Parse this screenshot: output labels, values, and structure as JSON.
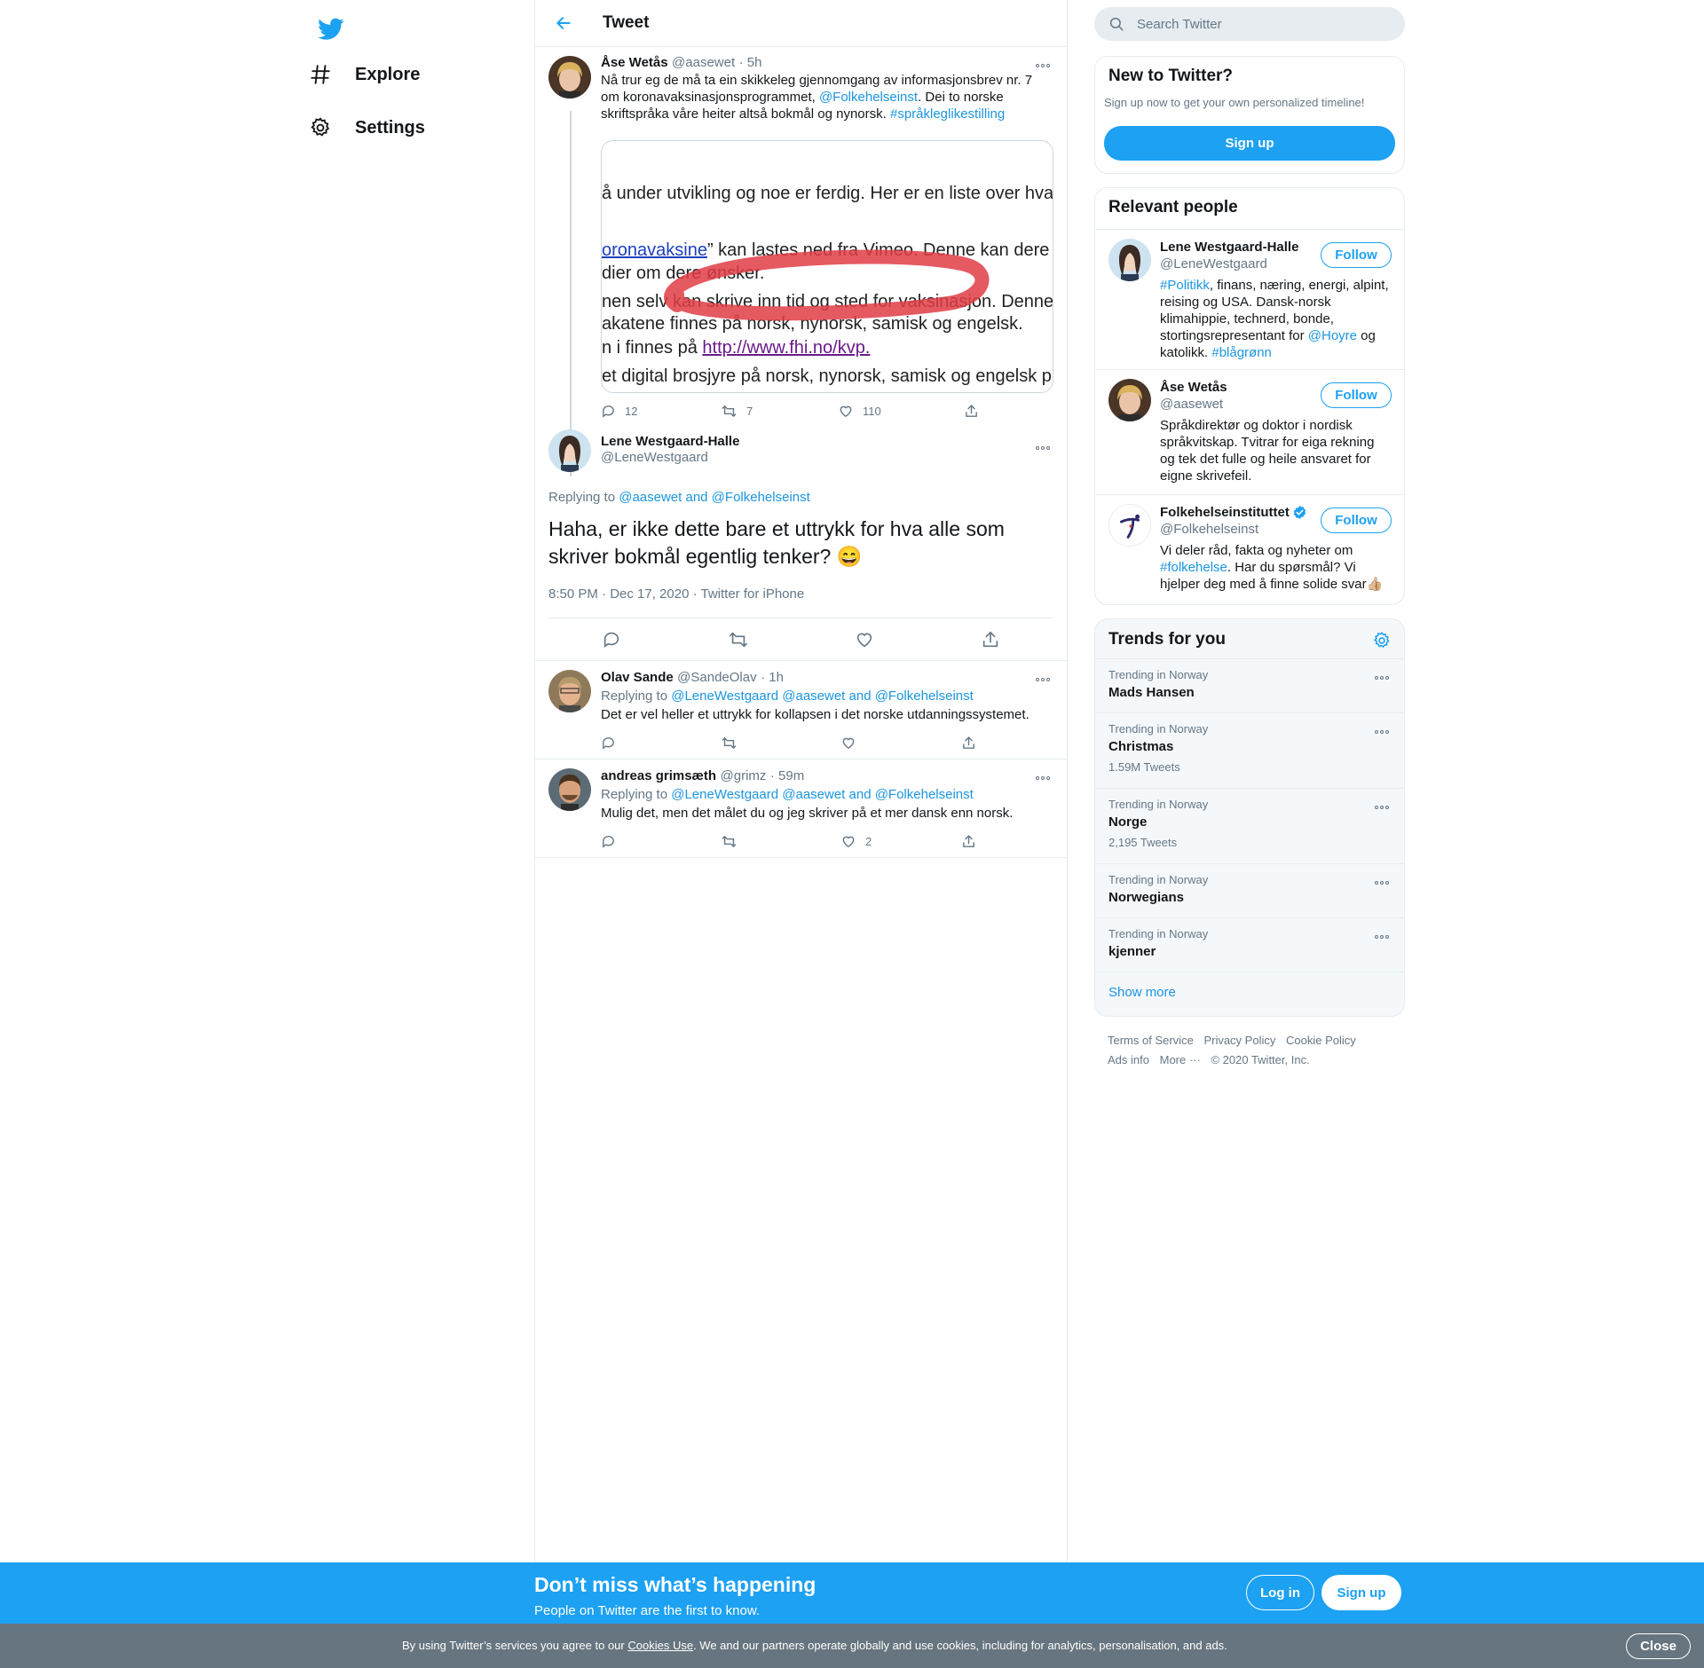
{
  "nav": {
    "items": [
      {
        "label": "Explore",
        "icon": "hashtag-icon"
      },
      {
        "label": "Settings",
        "icon": "gear-icon"
      }
    ]
  },
  "header": {
    "title": "Tweet"
  },
  "parent_tweet": {
    "name": "Åse Wetås",
    "handle": "@aasewet",
    "time": "· 5h",
    "text_1": "Nå trur eg de må ta ein skikkeleg gjennomgang av informasjonsbrev nr. 7 om koronavaksinasjonsprogrammet, ",
    "mention": "@Folkehelseinst",
    "text_2": ". Dei to norske skriftspråka våre heiter altså bokmål og nynorsk. ",
    "hashtag": "#språkleglikestilling",
    "image_lines": [
      "å under utvikling og noe er ferdig. Her er en liste over hva so",
      "oronavaksine",
      "” kan lastes ned fra Vimeo. Denne kan dere legg",
      "dier om dere ønsker.",
      "nen selv kan skrive inn tid og sted for vaksinasjon. Denne vil",
      "akatene finnes på norsk, nynorsk, samisk og engelsk.",
      "n i finnes på ",
      "http://www.fhi.no/kvp.",
      "et digital brosjyre på norsk, nynorsk, samisk og engelsk publ"
    ],
    "replies": "12",
    "retweets": "7",
    "likes": "110"
  },
  "focus_tweet": {
    "name": "Lene Westgaard-Halle",
    "handle": "@LeneWestgaard",
    "replying_label": "Replying to ",
    "replying_to": "@aasewet and @Folkehelseinst",
    "text": "Haha, er ikke dette bare et uttrykk for hva alle som skriver bokmål egentlig tenker? 😄",
    "meta": "8:50 PM · Dec 17, 2020 · Twitter for iPhone"
  },
  "replies": [
    {
      "name": "Olav Sande",
      "handle": "@SandeOlav",
      "time": "· 1h",
      "replying_label": "Replying to ",
      "replying_to": "@LeneWestgaard @aasewet and @Folkehelseinst",
      "text": "Det er vel heller et uttrykk for kollapsen i det norske utdanningssystemet.",
      "likes": ""
    },
    {
      "name": "andreas grimsæth",
      "handle": "@grimz",
      "time": "· 59m",
      "replying_label": "Replying to ",
      "replying_to": "@LeneWestgaard @aasewet and @Folkehelseinst",
      "text": "Mulig det, men det målet du og jeg skriver på et mer dansk enn norsk.",
      "likes": "2"
    }
  ],
  "search": {
    "placeholder": "Search Twitter"
  },
  "new_to_twitter": {
    "title": "New to Twitter?",
    "subtitle": "Sign up now to get your own personalized timeline!",
    "button": "Sign up"
  },
  "relevant_people": {
    "title": "Relevant people",
    "follow_label": "Follow",
    "people": [
      {
        "name": "Lene Westgaard-Halle",
        "handle": "@LeneWestgaard",
        "bio_hashtag": "#Politikk",
        "bio_1": ", finans, næring, energi, alpint, reising og USA. Dansk-norsk klimahippie, technerd, bonde, stortingsrepresentant for ",
        "bio_mention": "@Hoyre",
        "bio_2": " og katolikk. ",
        "bio_hashtag2": "#blågrønn"
      },
      {
        "name": "Åse Wetås",
        "handle": "@aasewet",
        "bio": "Språkdirektør og doktor i nordisk språkvitskap. Tvitrar for eiga rekning og tek det fulle og heile ansvaret for eigne skrivefeil."
      },
      {
        "name": "Folkehelseinstituttet",
        "handle": "@Folkehelseinst",
        "verified": true,
        "bio_1": "Vi deler råd, fakta og nyheter om ",
        "bio_hashtag": "#folkehelse",
        "bio_2": ". Har du spørsmål? Vi hjelper deg med å finne solide svar👍🏼"
      }
    ]
  },
  "trends": {
    "title": "Trends for you",
    "items": [
      {
        "context": "Trending in Norway",
        "name": "Mads Hansen",
        "count": ""
      },
      {
        "context": "Trending in Norway",
        "name": "Christmas",
        "count": "1.59M Tweets"
      },
      {
        "context": "Trending in Norway",
        "name": "Norge",
        "count": "2,195 Tweets"
      },
      {
        "context": "Trending in Norway",
        "name": "Norwegians",
        "count": ""
      },
      {
        "context": "Trending in Norway",
        "name": "kjenner",
        "count": ""
      }
    ],
    "show_more": "Show more"
  },
  "footer": {
    "links": [
      "Terms of Service",
      "Privacy Policy",
      "Cookie Policy",
      "Ads info",
      "More ···"
    ],
    "copyright": "© 2020 Twitter, Inc."
  },
  "promo": {
    "title": "Don’t miss what’s happening",
    "subtitle": "People on Twitter are the first to know.",
    "login": "Log in",
    "signup": "Sign up"
  },
  "cookie": {
    "text_1": "By using Twitter’s services you agree to our ",
    "link": "Cookies Use",
    "text_2": ". We and our partners operate globally and use cookies, including for analytics, personalisation, and ads.",
    "close": "Close"
  },
  "colors": {
    "accent": "#1da1f2",
    "link": "#1b95e0",
    "muted": "#657786",
    "cookie_bar": "#66757f"
  }
}
